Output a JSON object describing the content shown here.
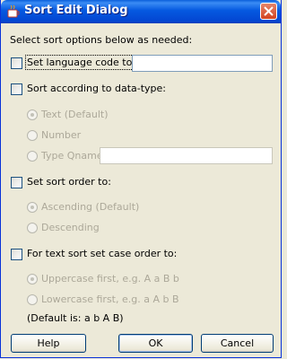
{
  "window": {
    "title": "Sort Edit Dialog",
    "icon": "java-cup-icon"
  },
  "intro_text": "Select sort options below as needed:",
  "language": {
    "checkbox_label": "Set language code to:",
    "checked": false,
    "value": ""
  },
  "datatype": {
    "checkbox_label": "Sort according to data-type:",
    "checked": false,
    "options": [
      {
        "label": "Text  (Default)",
        "selected": true
      },
      {
        "label": "Number",
        "selected": false
      },
      {
        "label": "Type Qname:",
        "selected": false
      }
    ],
    "qname_value": ""
  },
  "sortorder": {
    "checkbox_label": "Set sort order to:",
    "checked": false,
    "options": [
      {
        "label": "Ascending  (Default)",
        "selected": true
      },
      {
        "label": "Descending",
        "selected": false
      }
    ]
  },
  "caseorder": {
    "checkbox_label": "For text sort set case order to:",
    "checked": false,
    "options": [
      {
        "label": "Uppercase first, e.g. A a B b",
        "selected": true
      },
      {
        "label": "Lowercase first, e.g. a A b B",
        "selected": false
      }
    ],
    "default_note": "(Default is: a b A B)"
  },
  "buttons": {
    "help": "Help",
    "ok": "OK",
    "cancel": "Cancel"
  },
  "colors": {
    "titlebar": "#0559e0",
    "dialog_bg": "#ece9d8",
    "close_button": "#d4431f",
    "disabled_text": "#aca899"
  }
}
